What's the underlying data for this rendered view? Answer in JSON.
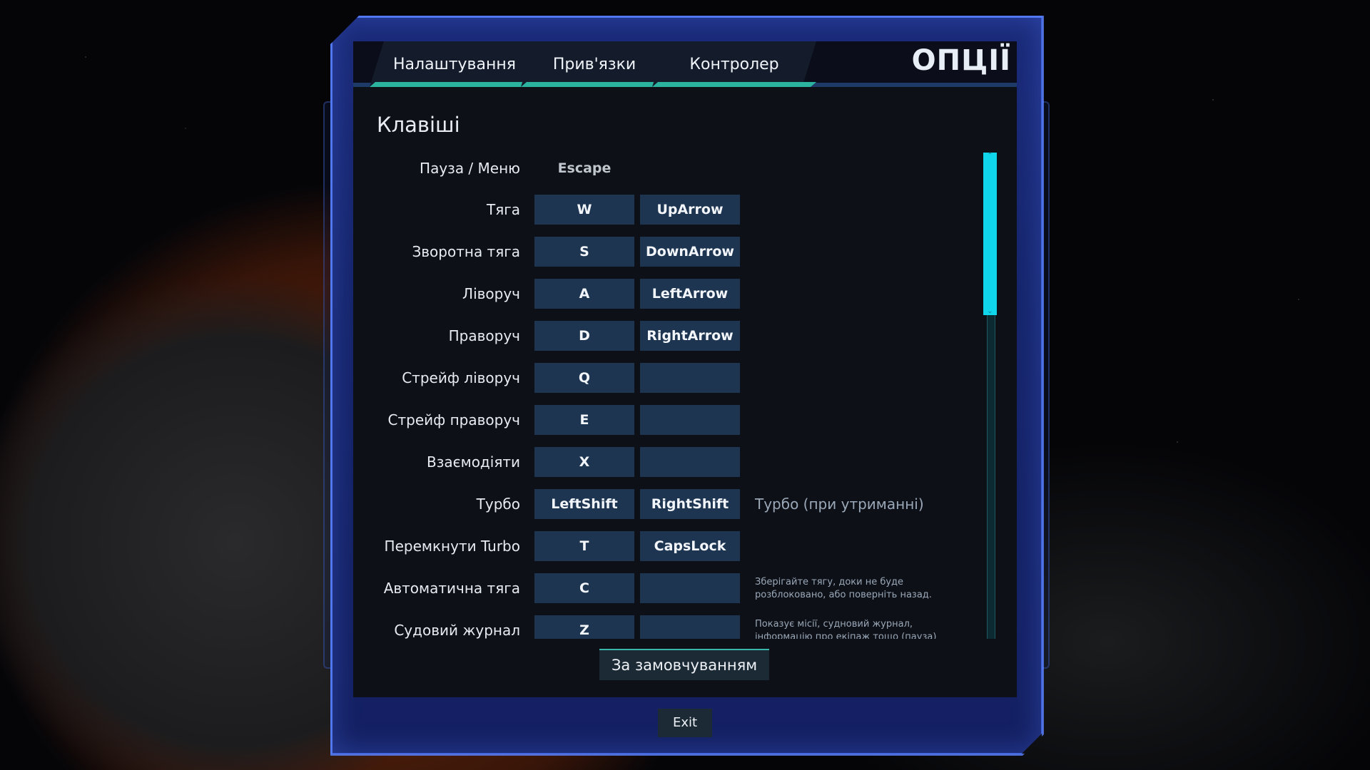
{
  "tabs": [
    {
      "label": "Налаштування"
    },
    {
      "label": "Прив'язки"
    },
    {
      "label": "Контролер"
    }
  ],
  "window_title": "ОПЦІЇ",
  "section_title": "Клавіші",
  "pause_row": {
    "label": "Пауза / Меню",
    "key": "Escape"
  },
  "rows": [
    {
      "label": "Тяга",
      "key1": "W",
      "key2": "UpArrow",
      "desc": ""
    },
    {
      "label": "Зворотна тяга",
      "key1": "S",
      "key2": "DownArrow",
      "desc": ""
    },
    {
      "label": "Ліворуч",
      "key1": "A",
      "key2": "LeftArrow",
      "desc": ""
    },
    {
      "label": "Праворуч",
      "key1": "D",
      "key2": "RightArrow",
      "desc": ""
    },
    {
      "label": "Стрейф ліворуч",
      "key1": "Q",
      "key2": "",
      "desc": ""
    },
    {
      "label": "Стрейф праворуч",
      "key1": "E",
      "key2": "",
      "desc": ""
    },
    {
      "label": "Взаємодіяти",
      "key1": "X",
      "key2": "",
      "desc": ""
    },
    {
      "label": "Турбо",
      "key1": "LeftShift",
      "key2": "RightShift",
      "desc": "Турбо (при утриманні)"
    },
    {
      "label": "Перемкнути Turbo",
      "key1": "T",
      "key2": "CapsLock",
      "desc": ""
    },
    {
      "label": "Автоматична тяга",
      "key1": "C",
      "key2": "",
      "desc_small": "Зберігайте тягу, доки не буде розблоковано, або поверніть назад."
    },
    {
      "label": "Судовий журнал",
      "key1": "Z",
      "key2": "",
      "desc_small": "Показує місії, судновий журнал, інформацію про екіпаж тощо (пауза)"
    }
  ],
  "scrollbar": {
    "position_fraction": 0.0,
    "visible_fraction": 0.33
  },
  "default_button": "За замовчуванням",
  "exit_button": "Exit",
  "colors": {
    "accent": "#2bb3a0",
    "scroll_thumb": "#10d6ec",
    "key_bg": "#1d3550"
  }
}
